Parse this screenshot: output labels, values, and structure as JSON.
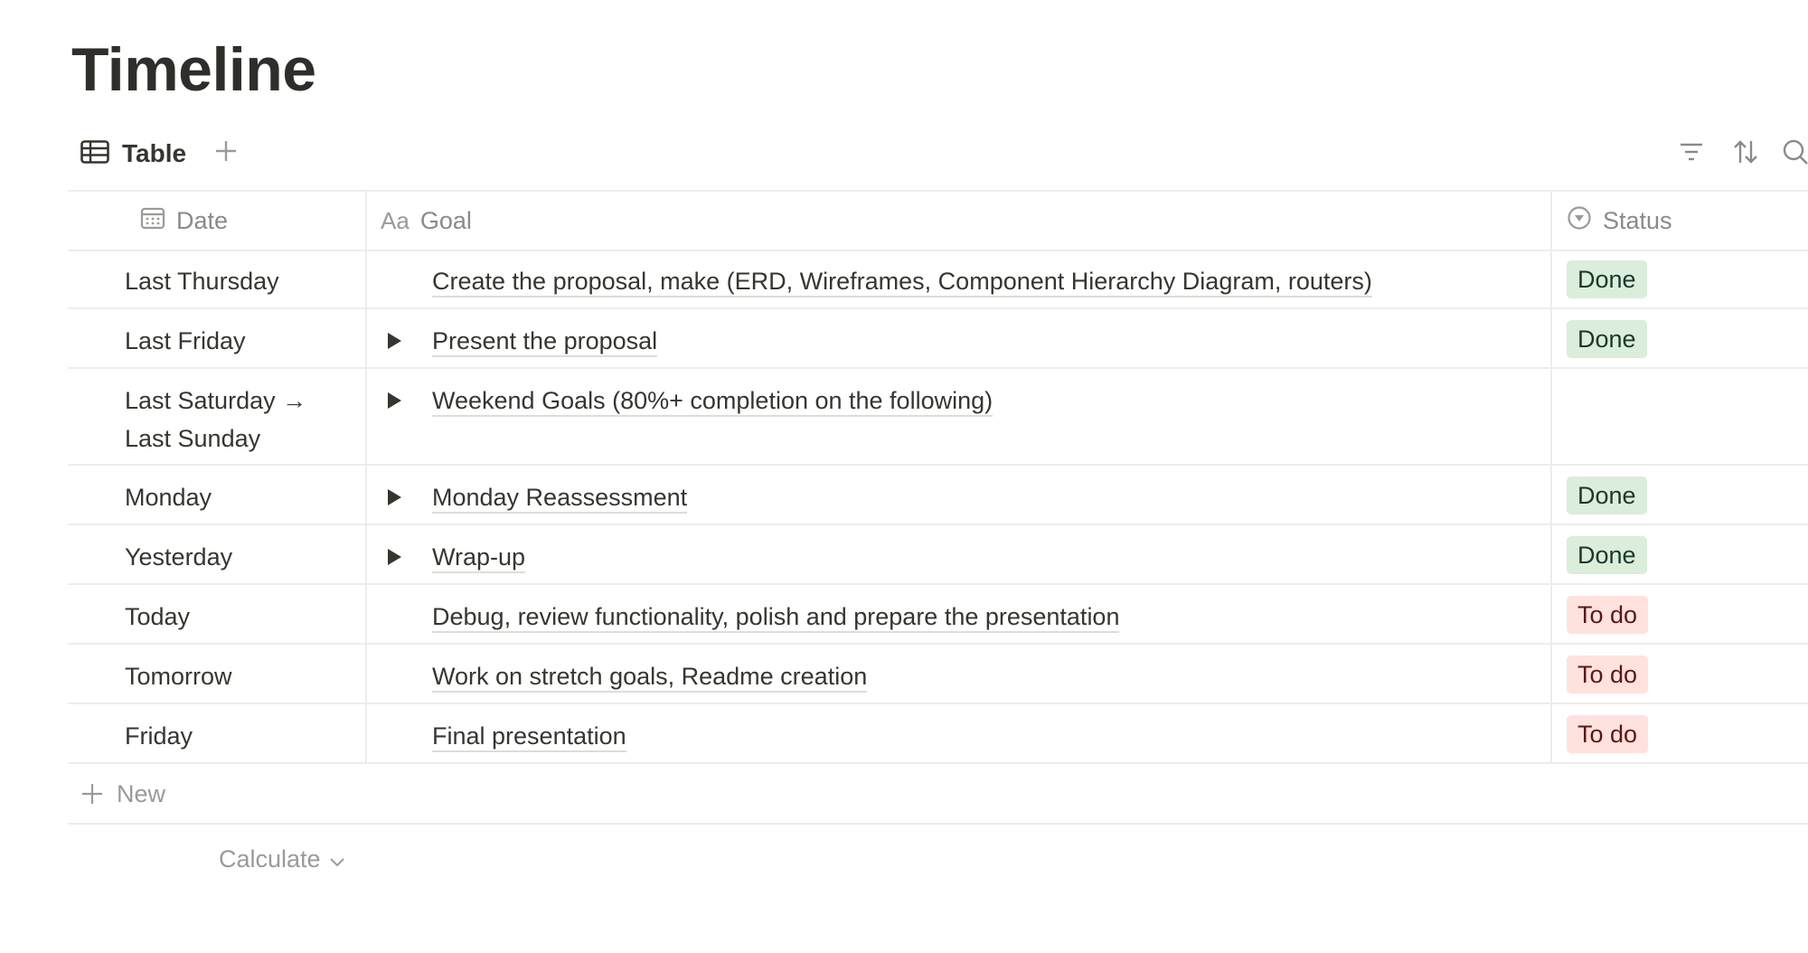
{
  "page": {
    "title": "Timeline"
  },
  "view": {
    "active_tab_label": "Table",
    "table_icon": "table-icon",
    "add_view_icon": "plus-icon",
    "tools": [
      "filter-icon",
      "sort-icon",
      "search-icon"
    ]
  },
  "table": {
    "columns": [
      {
        "label": "Date",
        "icon": "calendar-icon"
      },
      {
        "label": "Goal",
        "icon": "title-aa-icon",
        "icon_text": "Aa"
      },
      {
        "label": "Status",
        "icon": "status-icon"
      }
    ],
    "rows": [
      {
        "date": "Last Thursday",
        "goal": "Create the proposal, make (ERD, Wireframes, Component Hierarchy Diagram, routers)",
        "toggle": false,
        "status": "Done"
      },
      {
        "date": "Last Friday",
        "goal": "Present the proposal",
        "toggle": true,
        "status": "Done"
      },
      {
        "date": "Last Saturday →",
        "date_line2": "Last Sunday",
        "goal": "Weekend Goals (80%+ completion on the following)",
        "toggle": true,
        "status": ""
      },
      {
        "date": "Monday",
        "goal": "Monday Reassessment",
        "toggle": true,
        "status": "Done"
      },
      {
        "date": "Yesterday",
        "goal": "Wrap-up",
        "toggle": true,
        "status": "Done"
      },
      {
        "date": "Today",
        "goal": "Debug, review functionality, polish and prepare the presentation",
        "toggle": false,
        "status": "To do"
      },
      {
        "date": "Tomorrow",
        "goal": "Work on stretch goals, Readme creation",
        "toggle": false,
        "status": "To do"
      },
      {
        "date": "Friday",
        "goal": "Final presentation",
        "toggle": false,
        "status": "To do"
      }
    ],
    "new_label": "New",
    "calculate_label": "Calculate"
  },
  "colors": {
    "done_bg": "#dbeddb",
    "done_text": "#1c3829",
    "todo_bg": "#ffe2dd",
    "todo_text": "#5d1715",
    "border": "#ededec",
    "muted": "#9b9a97"
  }
}
